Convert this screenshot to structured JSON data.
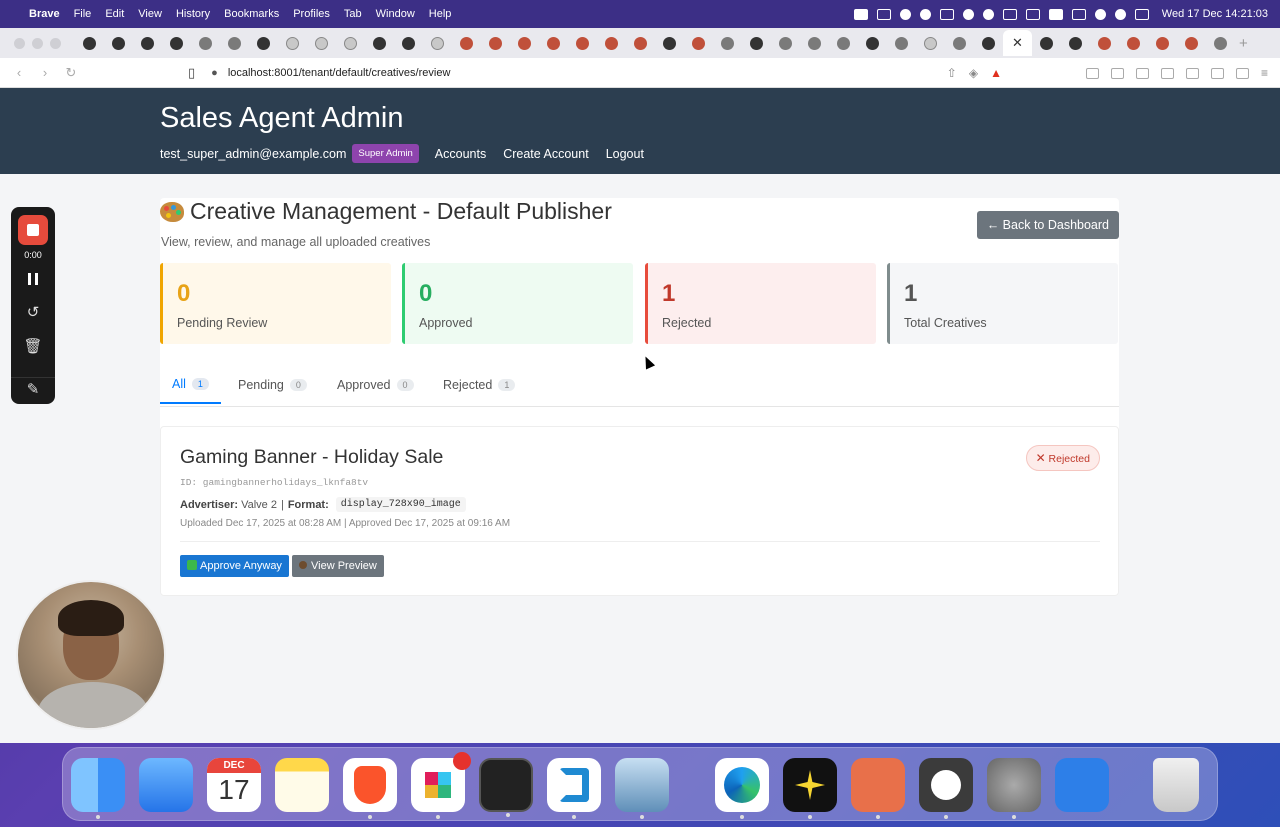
{
  "menubar": {
    "app": "Brave",
    "items": [
      "File",
      "Edit",
      "View",
      "History",
      "Bookmarks",
      "Profiles",
      "Tab",
      "Window",
      "Help"
    ],
    "datetime": "Wed 17 Dec 14:21:03"
  },
  "browser": {
    "url": "localhost:8001/tenant/default/creatives/review"
  },
  "header": {
    "title": "Sales Agent Admin",
    "user_email": "test_super_admin@example.com",
    "role_badge": "Super Admin",
    "nav": [
      "Accounts",
      "Create Account",
      "Logout"
    ]
  },
  "page": {
    "title": "Creative Management - Default Publisher",
    "subtitle": "View, review, and manage all uploaded creatives",
    "back_button": "← Back to Dashboard"
  },
  "stats": [
    {
      "value": "0",
      "label": "Pending Review",
      "color": "#f0a500",
      "bg": "#fff8ea",
      "num_color": "#e8a317"
    },
    {
      "value": "0",
      "label": "Approved",
      "color": "#2ecc71",
      "bg": "#eefbf2",
      "num_color": "#27ae60"
    },
    {
      "value": "1",
      "label": "Rejected",
      "color": "#e74c3c",
      "bg": "#fdeeee",
      "num_color": "#c0392b"
    },
    {
      "value": "1",
      "label": "Total Creatives",
      "color": "#7f8c8d",
      "bg": "#f5f6f8",
      "num_color": "#555"
    }
  ],
  "filter_tabs": [
    {
      "label": "All",
      "count": "1"
    },
    {
      "label": "Pending",
      "count": "0"
    },
    {
      "label": "Approved",
      "count": "0"
    },
    {
      "label": "Rejected",
      "count": "1"
    }
  ],
  "creative": {
    "name": "Gaming Banner - Holiday Sale",
    "id_label": "ID: gamingbannerholidays_lknfa8tv",
    "advertiser_label": "Advertiser:",
    "advertiser": "Valve 2",
    "format_label": "Format:",
    "format": "display_728x90_image",
    "dates": "Uploaded Dec 17, 2025 at 08:28 AM | Approved Dec 17, 2025 at 09:16 AM",
    "status": "Rejected",
    "approve_button": "Approve Anyway",
    "preview_button": "View Preview"
  },
  "recorder": {
    "time": "0:00"
  },
  "dock": {
    "calendar_month": "DEC",
    "calendar_day": "17"
  }
}
